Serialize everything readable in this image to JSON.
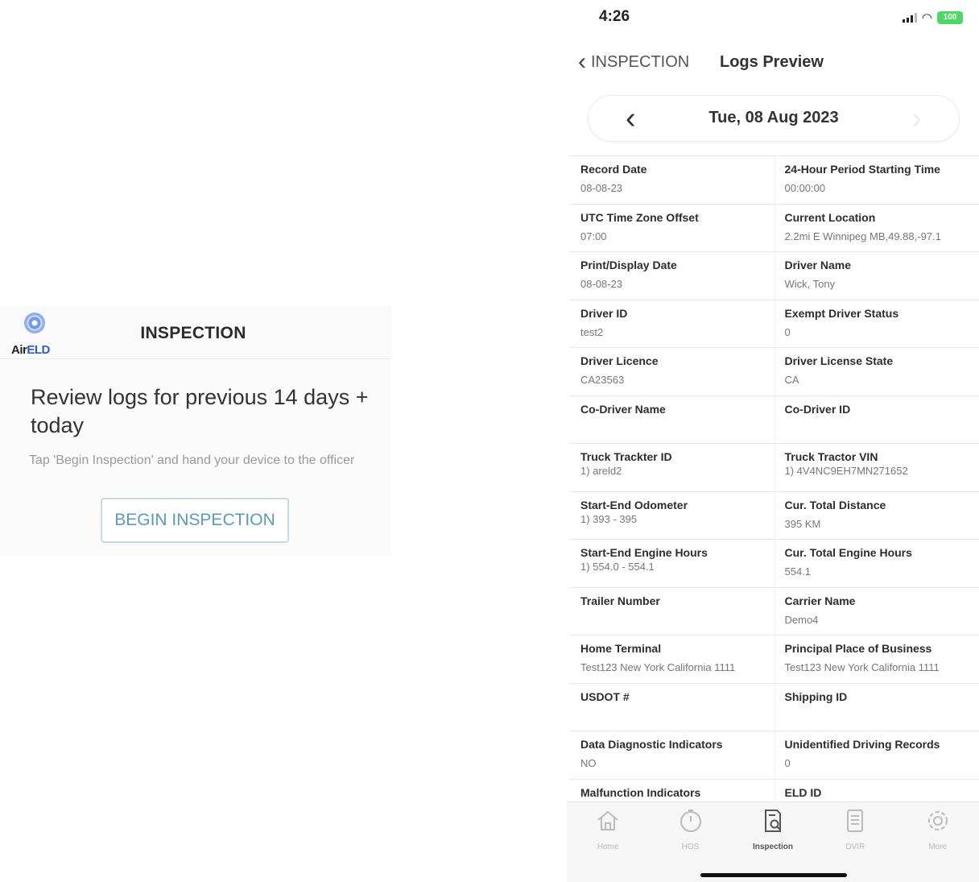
{
  "left": {
    "logo": {
      "part1": "Air",
      "part2": "ELD"
    },
    "title": "INSPECTION",
    "heading": "Review logs for previous 14 days + today",
    "hint": "Tap 'Begin Inspection' and hand your device to the officer",
    "button_label": "BEGIN INSPECTION"
  },
  "phone": {
    "status": {
      "time": "4:26",
      "battery": "100"
    },
    "nav": {
      "back_label": "INSPECTION",
      "title": "Logs Preview"
    },
    "date": "Tue, 08 Aug 2023",
    "rows": [
      [
        {
          "label": "Record Date",
          "value": "08-08-23"
        },
        {
          "label": "24-Hour Period Starting Time",
          "value": "00:00:00"
        }
      ],
      [
        {
          "label": "UTC Time Zone Offset",
          "value": "07:00"
        },
        {
          "label": "Current Location",
          "value": "2.2mi E Winnipeg MB,49.88,-97.1"
        }
      ],
      [
        {
          "label": "Print/Display Date",
          "value": "08-08-23"
        },
        {
          "label": "Driver Name",
          "value": "Wick, Tony"
        }
      ],
      [
        {
          "label": "Driver ID",
          "value": "test2"
        },
        {
          "label": "Exempt Driver Status",
          "value": "0"
        }
      ],
      [
        {
          "label": "Driver Licence",
          "value": "CA23563"
        },
        {
          "label": "Driver License State",
          "value": "CA"
        }
      ],
      [
        {
          "label": "Co-Driver Name",
          "value": ""
        },
        {
          "label": "Co-Driver ID",
          "value": ""
        }
      ],
      [
        {
          "label": "Truck Trackter ID",
          "value": "1) areld2"
        },
        {
          "label": "Truck Tractor VIN",
          "value": "1) 4V4NC9EH7MN271652"
        }
      ],
      [
        {
          "label": "Start-End Odometer",
          "value": "1) 393 - 395"
        },
        {
          "label": "Cur. Total Distance",
          "value": "395 KM"
        }
      ],
      [
        {
          "label": "Start-End Engine Hours",
          "value": "1) 554.0 - 554.1"
        },
        {
          "label": "Cur. Total Engine Hours",
          "value": "554.1"
        }
      ],
      [
        {
          "label": "Trailer Number",
          "value": ""
        },
        {
          "label": "Carrier Name",
          "value": "Demo4"
        }
      ],
      [
        {
          "label": "Home Terminal",
          "value": "Test123 New York California 1111"
        },
        {
          "label": "Principal Place of Business",
          "value": "Test123 New York California 1111"
        }
      ],
      [
        {
          "label": "USDOT #",
          "value": ""
        },
        {
          "label": "Shipping ID",
          "value": ""
        }
      ],
      [
        {
          "label": "Data Diagnostic Indicators",
          "value": "NO"
        },
        {
          "label": "Unidentified Driving Records",
          "value": "0"
        }
      ],
      [
        {
          "label": "Malfunction Indicators",
          "value": ""
        },
        {
          "label": "ELD ID",
          "value": ""
        }
      ]
    ],
    "tabs": [
      {
        "label": "Home",
        "icon": "home-icon"
      },
      {
        "label": "HOS",
        "icon": "clock-icon"
      },
      {
        "label": "Inspection",
        "icon": "inspection-icon"
      },
      {
        "label": "DVIR",
        "icon": "document-icon"
      },
      {
        "label": "More",
        "icon": "gear-icon"
      }
    ],
    "colors": {
      "accent_button_text": "#5a9bbd",
      "battery": "#4cd964",
      "logo_blue": "#2b5dcc"
    }
  }
}
